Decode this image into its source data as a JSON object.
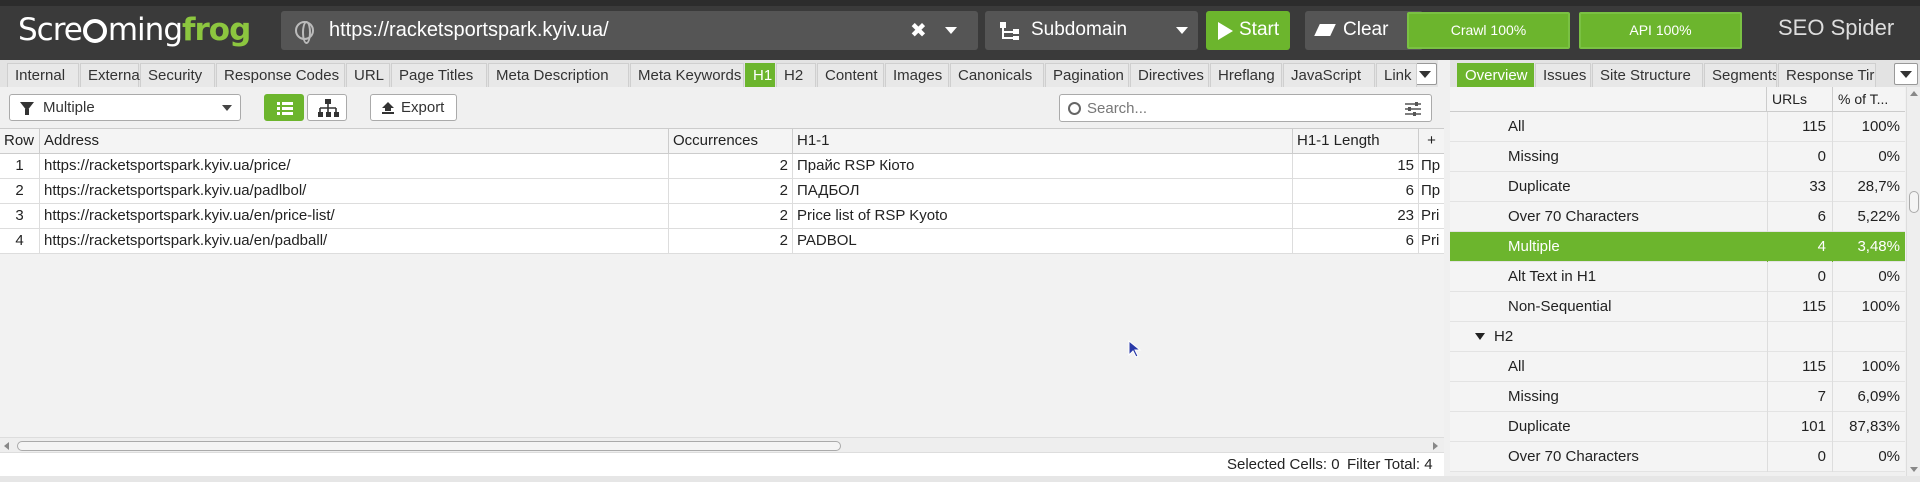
{
  "app": {
    "logo_text_1": "Scre",
    "logo_text_2": "ming",
    "logo_text_3": "frog",
    "brand": "SEO Spider",
    "accent_color": "#6cb52d"
  },
  "toolbar_top": {
    "url_value": "https://racketsportspark.kyiv.ua/",
    "mode": "Subdomain",
    "start_label": "Start",
    "clear_label": "Clear",
    "crawl_label": "Crawl 100%",
    "crawl_progress": 1.0,
    "api_label": "API 100%",
    "api_progress": 1.0
  },
  "tabs": [
    {
      "label": "Internal"
    },
    {
      "label": "External"
    },
    {
      "label": "Security"
    },
    {
      "label": "Response Codes"
    },
    {
      "label": "URL"
    },
    {
      "label": "Page Titles"
    },
    {
      "label": "Meta Description"
    },
    {
      "label": "Meta Keywords"
    },
    {
      "label": "H1",
      "active": true
    },
    {
      "label": "H2"
    },
    {
      "label": "Content"
    },
    {
      "label": "Images"
    },
    {
      "label": "Canonicals"
    },
    {
      "label": "Pagination"
    },
    {
      "label": "Directives"
    },
    {
      "label": "Hreflang"
    },
    {
      "label": "JavaScript"
    },
    {
      "label": "Link"
    }
  ],
  "filter": {
    "selected": "Multiple",
    "export_label": "Export",
    "search_placeholder": "Search..."
  },
  "table": {
    "columns": [
      "Row",
      "Address",
      "Occurrences",
      "H1-1",
      "H1-1 Length",
      "+"
    ],
    "rows": [
      {
        "row": "1",
        "address": "https://racketsportspark.kyiv.ua/price/",
        "occurrences": "2",
        "h1": "Прайс RSP Кіото",
        "length": "15",
        "h2": "Пр"
      },
      {
        "row": "2",
        "address": "https://racketsportspark.kyiv.ua/padlbol/",
        "occurrences": "2",
        "h1": "ПАДБОЛ",
        "length": "6",
        "h2": "Пр"
      },
      {
        "row": "3",
        "address": "https://racketsportspark.kyiv.ua/en/price-list/",
        "occurrences": "2",
        "h1": "Price list of RSP Kyoto",
        "length": "23",
        "h2": "Pri"
      },
      {
        "row": "4",
        "address": "https://racketsportspark.kyiv.ua/en/padball/",
        "occurrences": "2",
        "h1": "PADBOL",
        "length": "6",
        "h2": "Pri"
      }
    ]
  },
  "status": {
    "selected_cells": "Selected Cells:  0",
    "filter_total": "Filter Total:  4"
  },
  "right_panel": {
    "tabs": [
      {
        "label": "Overview",
        "active": true
      },
      {
        "label": "Issues"
      },
      {
        "label": "Site Structure"
      },
      {
        "label": "Segments"
      },
      {
        "label": "Response Tir"
      }
    ],
    "header_urls": "URLs",
    "header_pct": "% of T...",
    "rows": [
      {
        "label": "All",
        "count": "115",
        "pct": "100%"
      },
      {
        "label": "Missing",
        "count": "0",
        "pct": "0%"
      },
      {
        "label": "Duplicate",
        "count": "33",
        "pct": "28,7%"
      },
      {
        "label": "Over 70 Characters",
        "count": "6",
        "pct": "5,22%"
      },
      {
        "label": "Multiple",
        "count": "4",
        "pct": "3,48%",
        "selected": true
      },
      {
        "label": "Alt Text in H1",
        "count": "0",
        "pct": "0%"
      },
      {
        "label": "Non-Sequential",
        "count": "115",
        "pct": "100%"
      },
      {
        "label": "H2",
        "count": "",
        "pct": "",
        "group": true
      },
      {
        "label": "All",
        "count": "115",
        "pct": "100%"
      },
      {
        "label": "Missing",
        "count": "7",
        "pct": "6,09%"
      },
      {
        "label": "Duplicate",
        "count": "101",
        "pct": "87,83%"
      },
      {
        "label": "Over 70 Characters",
        "count": "0",
        "pct": "0%"
      }
    ]
  }
}
